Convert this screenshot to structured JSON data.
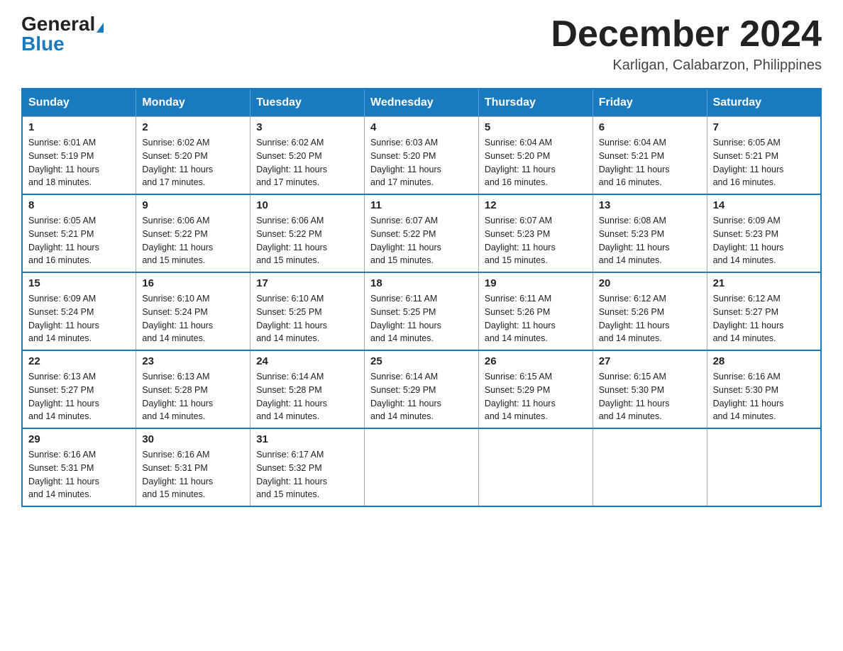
{
  "header": {
    "logo_general": "General",
    "logo_blue": "Blue",
    "month_title": "December 2024",
    "location": "Karligan, Calabarzon, Philippines"
  },
  "days_of_week": [
    "Sunday",
    "Monday",
    "Tuesday",
    "Wednesday",
    "Thursday",
    "Friday",
    "Saturday"
  ],
  "weeks": [
    [
      {
        "day": "1",
        "sunrise": "6:01 AM",
        "sunset": "5:19 PM",
        "daylight": "11 hours and 18 minutes."
      },
      {
        "day": "2",
        "sunrise": "6:02 AM",
        "sunset": "5:20 PM",
        "daylight": "11 hours and 17 minutes."
      },
      {
        "day": "3",
        "sunrise": "6:02 AM",
        "sunset": "5:20 PM",
        "daylight": "11 hours and 17 minutes."
      },
      {
        "day": "4",
        "sunrise": "6:03 AM",
        "sunset": "5:20 PM",
        "daylight": "11 hours and 17 minutes."
      },
      {
        "day": "5",
        "sunrise": "6:04 AM",
        "sunset": "5:20 PM",
        "daylight": "11 hours and 16 minutes."
      },
      {
        "day": "6",
        "sunrise": "6:04 AM",
        "sunset": "5:21 PM",
        "daylight": "11 hours and 16 minutes."
      },
      {
        "day": "7",
        "sunrise": "6:05 AM",
        "sunset": "5:21 PM",
        "daylight": "11 hours and 16 minutes."
      }
    ],
    [
      {
        "day": "8",
        "sunrise": "6:05 AM",
        "sunset": "5:21 PM",
        "daylight": "11 hours and 16 minutes."
      },
      {
        "day": "9",
        "sunrise": "6:06 AM",
        "sunset": "5:22 PM",
        "daylight": "11 hours and 15 minutes."
      },
      {
        "day": "10",
        "sunrise": "6:06 AM",
        "sunset": "5:22 PM",
        "daylight": "11 hours and 15 minutes."
      },
      {
        "day": "11",
        "sunrise": "6:07 AM",
        "sunset": "5:22 PM",
        "daylight": "11 hours and 15 minutes."
      },
      {
        "day": "12",
        "sunrise": "6:07 AM",
        "sunset": "5:23 PM",
        "daylight": "11 hours and 15 minutes."
      },
      {
        "day": "13",
        "sunrise": "6:08 AM",
        "sunset": "5:23 PM",
        "daylight": "11 hours and 14 minutes."
      },
      {
        "day": "14",
        "sunrise": "6:09 AM",
        "sunset": "5:23 PM",
        "daylight": "11 hours and 14 minutes."
      }
    ],
    [
      {
        "day": "15",
        "sunrise": "6:09 AM",
        "sunset": "5:24 PM",
        "daylight": "11 hours and 14 minutes."
      },
      {
        "day": "16",
        "sunrise": "6:10 AM",
        "sunset": "5:24 PM",
        "daylight": "11 hours and 14 minutes."
      },
      {
        "day": "17",
        "sunrise": "6:10 AM",
        "sunset": "5:25 PM",
        "daylight": "11 hours and 14 minutes."
      },
      {
        "day": "18",
        "sunrise": "6:11 AM",
        "sunset": "5:25 PM",
        "daylight": "11 hours and 14 minutes."
      },
      {
        "day": "19",
        "sunrise": "6:11 AM",
        "sunset": "5:26 PM",
        "daylight": "11 hours and 14 minutes."
      },
      {
        "day": "20",
        "sunrise": "6:12 AM",
        "sunset": "5:26 PM",
        "daylight": "11 hours and 14 minutes."
      },
      {
        "day": "21",
        "sunrise": "6:12 AM",
        "sunset": "5:27 PM",
        "daylight": "11 hours and 14 minutes."
      }
    ],
    [
      {
        "day": "22",
        "sunrise": "6:13 AM",
        "sunset": "5:27 PM",
        "daylight": "11 hours and 14 minutes."
      },
      {
        "day": "23",
        "sunrise": "6:13 AM",
        "sunset": "5:28 PM",
        "daylight": "11 hours and 14 minutes."
      },
      {
        "day": "24",
        "sunrise": "6:14 AM",
        "sunset": "5:28 PM",
        "daylight": "11 hours and 14 minutes."
      },
      {
        "day": "25",
        "sunrise": "6:14 AM",
        "sunset": "5:29 PM",
        "daylight": "11 hours and 14 minutes."
      },
      {
        "day": "26",
        "sunrise": "6:15 AM",
        "sunset": "5:29 PM",
        "daylight": "11 hours and 14 minutes."
      },
      {
        "day": "27",
        "sunrise": "6:15 AM",
        "sunset": "5:30 PM",
        "daylight": "11 hours and 14 minutes."
      },
      {
        "day": "28",
        "sunrise": "6:16 AM",
        "sunset": "5:30 PM",
        "daylight": "11 hours and 14 minutes."
      }
    ],
    [
      {
        "day": "29",
        "sunrise": "6:16 AM",
        "sunset": "5:31 PM",
        "daylight": "11 hours and 14 minutes."
      },
      {
        "day": "30",
        "sunrise": "6:16 AM",
        "sunset": "5:31 PM",
        "daylight": "11 hours and 15 minutes."
      },
      {
        "day": "31",
        "sunrise": "6:17 AM",
        "sunset": "5:32 PM",
        "daylight": "11 hours and 15 minutes."
      },
      null,
      null,
      null,
      null
    ]
  ],
  "labels": {
    "sunrise": "Sunrise:",
    "sunset": "Sunset:",
    "daylight": "Daylight:"
  }
}
